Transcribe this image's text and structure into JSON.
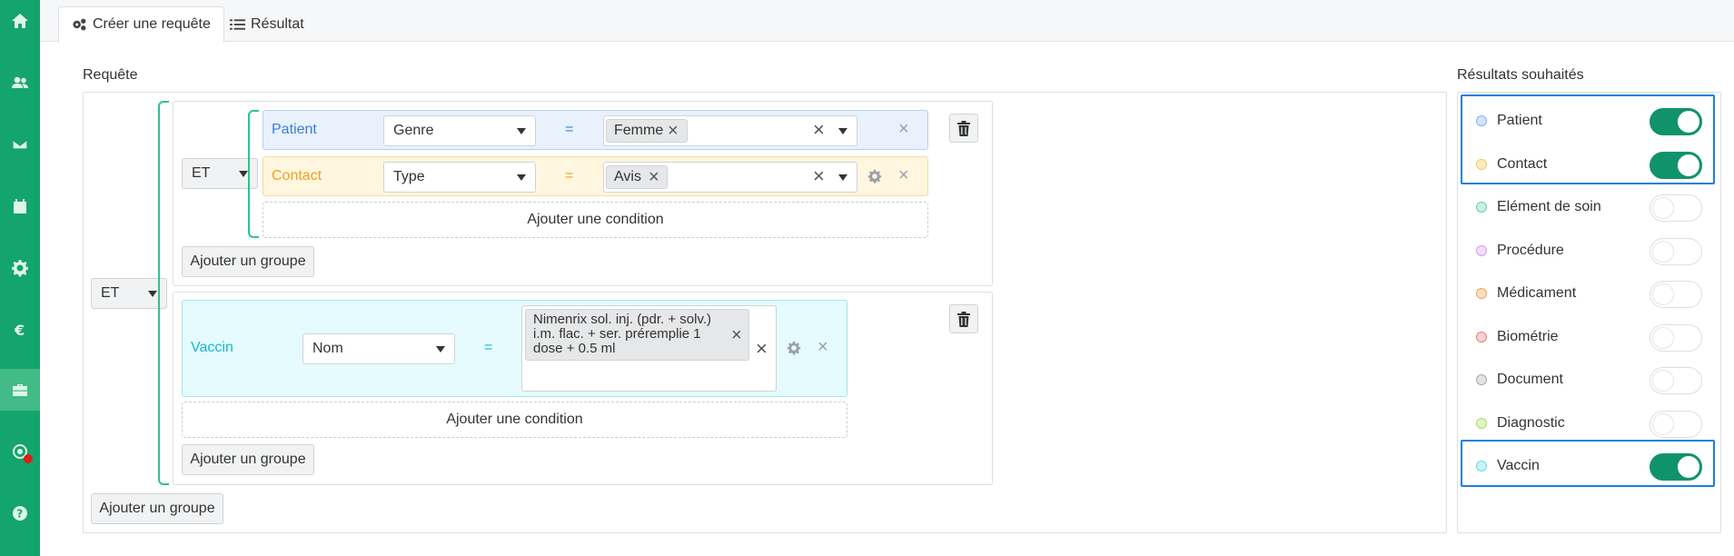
{
  "tabs": [
    {
      "label": "Créer une requête",
      "icon": "gears-icon",
      "active": true
    },
    {
      "label": "Résultat",
      "icon": "list-icon",
      "active": false
    }
  ],
  "sidebar": {
    "items": [
      "home-icon",
      "users-icon",
      "envelope-icon",
      "calendar-icon",
      "gear-icon",
      "euro-icon",
      "medkit-icon",
      "support-icon",
      "help-icon"
    ],
    "active": "medkit-icon",
    "notification_color": "#e41919"
  },
  "query": {
    "label": "Requête",
    "root_operator": "ET",
    "groups": [
      {
        "operator": "ET",
        "conditions": [
          {
            "entity": "Patient",
            "field": "Genre",
            "operator": "=",
            "values": [
              "Femme"
            ]
          },
          {
            "entity": "Contact",
            "field": "Type",
            "operator": "=",
            "values": [
              "Avis"
            ]
          }
        ],
        "add_condition": "Ajouter une condition",
        "add_group": "Ajouter un groupe"
      },
      {
        "conditions": [
          {
            "entity": "Vaccin",
            "field": "Nom",
            "operator": "=",
            "values": [
              "Nimenrix sol. inj. (pdr. + solv.) i.m. flac. + ser. préremplie 1 dose + 0.5 ml"
            ]
          }
        ],
        "add_condition": "Ajouter une condition",
        "add_group": "Ajouter un groupe"
      }
    ],
    "add_group": "Ajouter un groupe"
  },
  "results": {
    "label": "Résultats souhaités",
    "items": [
      {
        "label": "Patient",
        "color": "#7fb2ef",
        "enabled": true,
        "highlighted": true
      },
      {
        "label": "Contact",
        "color": "#f2c94c",
        "enabled": true,
        "highlighted": true
      },
      {
        "label": "Elément de soin",
        "color": "#5fd3a6",
        "enabled": false,
        "highlighted": false
      },
      {
        "label": "Procédure",
        "color": "#d69cf0",
        "enabled": false,
        "highlighted": false
      },
      {
        "label": "Médicament",
        "color": "#f6a04d",
        "enabled": false,
        "highlighted": false
      },
      {
        "label": "Biométrie",
        "color": "#f07b7b",
        "enabled": false,
        "highlighted": false
      },
      {
        "label": "Document",
        "color": "#a7a9ac",
        "enabled": false,
        "highlighted": false
      },
      {
        "label": "Diagnostic",
        "color": "#a6e05c",
        "enabled": false,
        "highlighted": false
      },
      {
        "label": "Vaccin",
        "color": "#62dbe8",
        "enabled": true,
        "highlighted": true
      }
    ]
  },
  "colors": {
    "sidebar": "#13a56b",
    "toggle_on": "#10936a",
    "bracket": "#2cc48a",
    "highlight_border": "#1e7fe0",
    "patient_text": "#3a7ed6",
    "contact_text": "#f0a020",
    "vaccin_text": "#19b8cc"
  }
}
